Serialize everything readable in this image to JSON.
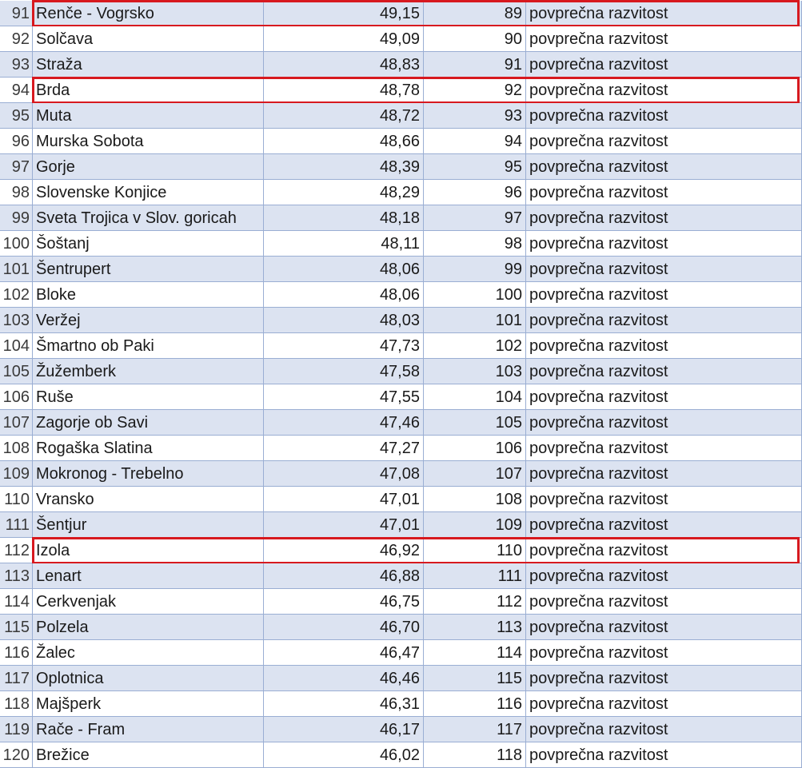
{
  "highlight_color": "#d7191f",
  "band_color": "#dce3f1",
  "grid_color": "#9aaed3",
  "rows": [
    {
      "num": "91",
      "name": "Renče - Vogrsko",
      "score": "49,15",
      "rank": "89",
      "category": "povprečna razvitost",
      "highlighted": true
    },
    {
      "num": "92",
      "name": "Solčava",
      "score": "49,09",
      "rank": "90",
      "category": "povprečna razvitost",
      "highlighted": false
    },
    {
      "num": "93",
      "name": "Straža",
      "score": "48,83",
      "rank": "91",
      "category": "povprečna razvitost",
      "highlighted": false
    },
    {
      "num": "94",
      "name": "Brda",
      "score": "48,78",
      "rank": "92",
      "category": "povprečna razvitost",
      "highlighted": true
    },
    {
      "num": "95",
      "name": "Muta",
      "score": "48,72",
      "rank": "93",
      "category": "povprečna razvitost",
      "highlighted": false
    },
    {
      "num": "96",
      "name": "Murska Sobota",
      "score": "48,66",
      "rank": "94",
      "category": "povprečna razvitost",
      "highlighted": false
    },
    {
      "num": "97",
      "name": "Gorje",
      "score": "48,39",
      "rank": "95",
      "category": "povprečna razvitost",
      "highlighted": false
    },
    {
      "num": "98",
      "name": "Slovenske Konjice",
      "score": "48,29",
      "rank": "96",
      "category": "povprečna razvitost",
      "highlighted": false
    },
    {
      "num": "99",
      "name": "Sveta Trojica v Slov. goricah",
      "score": "48,18",
      "rank": "97",
      "category": "povprečna razvitost",
      "highlighted": false
    },
    {
      "num": "100",
      "name": "Šoštanj",
      "score": "48,11",
      "rank": "98",
      "category": "povprečna razvitost",
      "highlighted": false
    },
    {
      "num": "101",
      "name": "Šentrupert",
      "score": "48,06",
      "rank": "99",
      "category": "povprečna razvitost",
      "highlighted": false
    },
    {
      "num": "102",
      "name": "Bloke",
      "score": "48,06",
      "rank": "100",
      "category": "povprečna razvitost",
      "highlighted": false
    },
    {
      "num": "103",
      "name": "Veržej",
      "score": "48,03",
      "rank": "101",
      "category": "povprečna razvitost",
      "highlighted": false
    },
    {
      "num": "104",
      "name": "Šmartno ob Paki",
      "score": "47,73",
      "rank": "102",
      "category": "povprečna razvitost",
      "highlighted": false
    },
    {
      "num": "105",
      "name": "Žužemberk",
      "score": "47,58",
      "rank": "103",
      "category": "povprečna razvitost",
      "highlighted": false
    },
    {
      "num": "106",
      "name": "Ruše",
      "score": "47,55",
      "rank": "104",
      "category": "povprečna razvitost",
      "highlighted": false
    },
    {
      "num": "107",
      "name": "Zagorje ob Savi",
      "score": "47,46",
      "rank": "105",
      "category": "povprečna razvitost",
      "highlighted": false
    },
    {
      "num": "108",
      "name": "Rogaška Slatina",
      "score": "47,27",
      "rank": "106",
      "category": "povprečna razvitost",
      "highlighted": false
    },
    {
      "num": "109",
      "name": "Mokronog - Trebelno",
      "score": "47,08",
      "rank": "107",
      "category": "povprečna razvitost",
      "highlighted": false
    },
    {
      "num": "110",
      "name": "Vransko",
      "score": "47,01",
      "rank": "108",
      "category": "povprečna razvitost",
      "highlighted": false
    },
    {
      "num": "111",
      "name": "Šentjur",
      "score": "47,01",
      "rank": "109",
      "category": "povprečna razvitost",
      "highlighted": false
    },
    {
      "num": "112",
      "name": "Izola",
      "score": "46,92",
      "rank": "110",
      "category": "povprečna razvitost",
      "highlighted": true
    },
    {
      "num": "113",
      "name": "Lenart",
      "score": "46,88",
      "rank": "111",
      "category": "povprečna razvitost",
      "highlighted": false
    },
    {
      "num": "114",
      "name": "Cerkvenjak",
      "score": "46,75",
      "rank": "112",
      "category": "povprečna razvitost",
      "highlighted": false
    },
    {
      "num": "115",
      "name": "Polzela",
      "score": "46,70",
      "rank": "113",
      "category": "povprečna razvitost",
      "highlighted": false
    },
    {
      "num": "116",
      "name": "Žalec",
      "score": "46,47",
      "rank": "114",
      "category": "povprečna razvitost",
      "highlighted": false
    },
    {
      "num": "117",
      "name": "Oplotnica",
      "score": "46,46",
      "rank": "115",
      "category": "povprečna razvitost",
      "highlighted": false
    },
    {
      "num": "118",
      "name": "Majšperk",
      "score": "46,31",
      "rank": "116",
      "category": "povprečna razvitost",
      "highlighted": false
    },
    {
      "num": "119",
      "name": "Rače - Fram",
      "score": "46,17",
      "rank": "117",
      "category": "povprečna razvitost",
      "highlighted": false
    },
    {
      "num": "120",
      "name": "Brežice",
      "score": "46,02",
      "rank": "118",
      "category": "povprečna razvitost",
      "highlighted": false
    }
  ]
}
